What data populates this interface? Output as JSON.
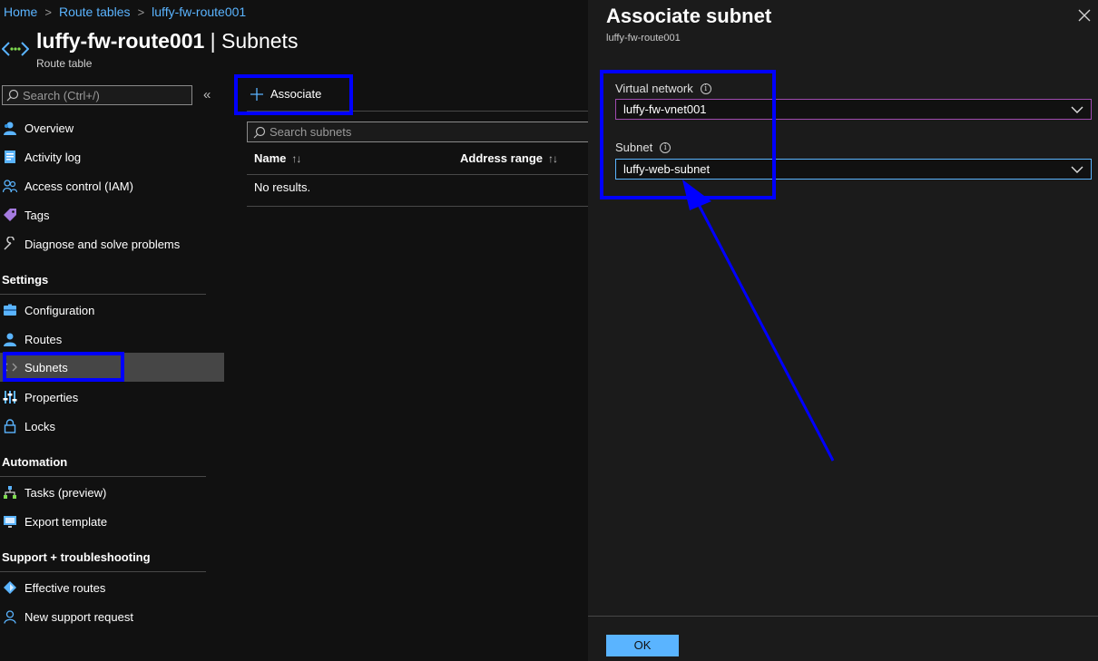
{
  "breadcrumb": {
    "home": "Home",
    "route_tables": "Route tables",
    "current": "luffy-fw-route001",
    "sep": ">"
  },
  "header": {
    "resource_name": "luffy-fw-route001",
    "page": " | Subnets",
    "subtitle": "Route table"
  },
  "sidebar": {
    "search_placeholder": "Search (Ctrl+/)",
    "collapse": "«",
    "items_top": [
      {
        "label": "Overview"
      },
      {
        "label": "Activity log"
      },
      {
        "label": "Access control (IAM)"
      },
      {
        "label": "Tags"
      },
      {
        "label": "Diagnose and solve problems"
      }
    ],
    "settings_head": "Settings",
    "settings_items": [
      {
        "label": "Configuration"
      },
      {
        "label": "Routes"
      },
      {
        "label": "Subnets"
      },
      {
        "label": "Properties"
      },
      {
        "label": "Locks"
      }
    ],
    "automation_head": "Automation",
    "automation_items": [
      {
        "label": "Tasks (preview)"
      },
      {
        "label": "Export template"
      }
    ],
    "support_head": "Support + troubleshooting",
    "support_items": [
      {
        "label": "Effective routes"
      },
      {
        "label": "New support request"
      }
    ]
  },
  "main": {
    "associate_label": "Associate",
    "search_placeholder": "Search subnets",
    "columns": [
      "Name",
      "Address range"
    ],
    "empty": "No results."
  },
  "blade": {
    "title": "Associate subnet",
    "subtitle": "luffy-fw-route001",
    "vnet_label": "Virtual network",
    "vnet_value": "luffy-fw-vnet001",
    "subnet_label": "Subnet",
    "subnet_value": "luffy-web-subnet",
    "ok_label": "OK",
    "info": "i"
  },
  "colors": {
    "accent": "#5ab4ff",
    "annotation": "#0000ff",
    "vnet_border": "#a04bb0"
  }
}
